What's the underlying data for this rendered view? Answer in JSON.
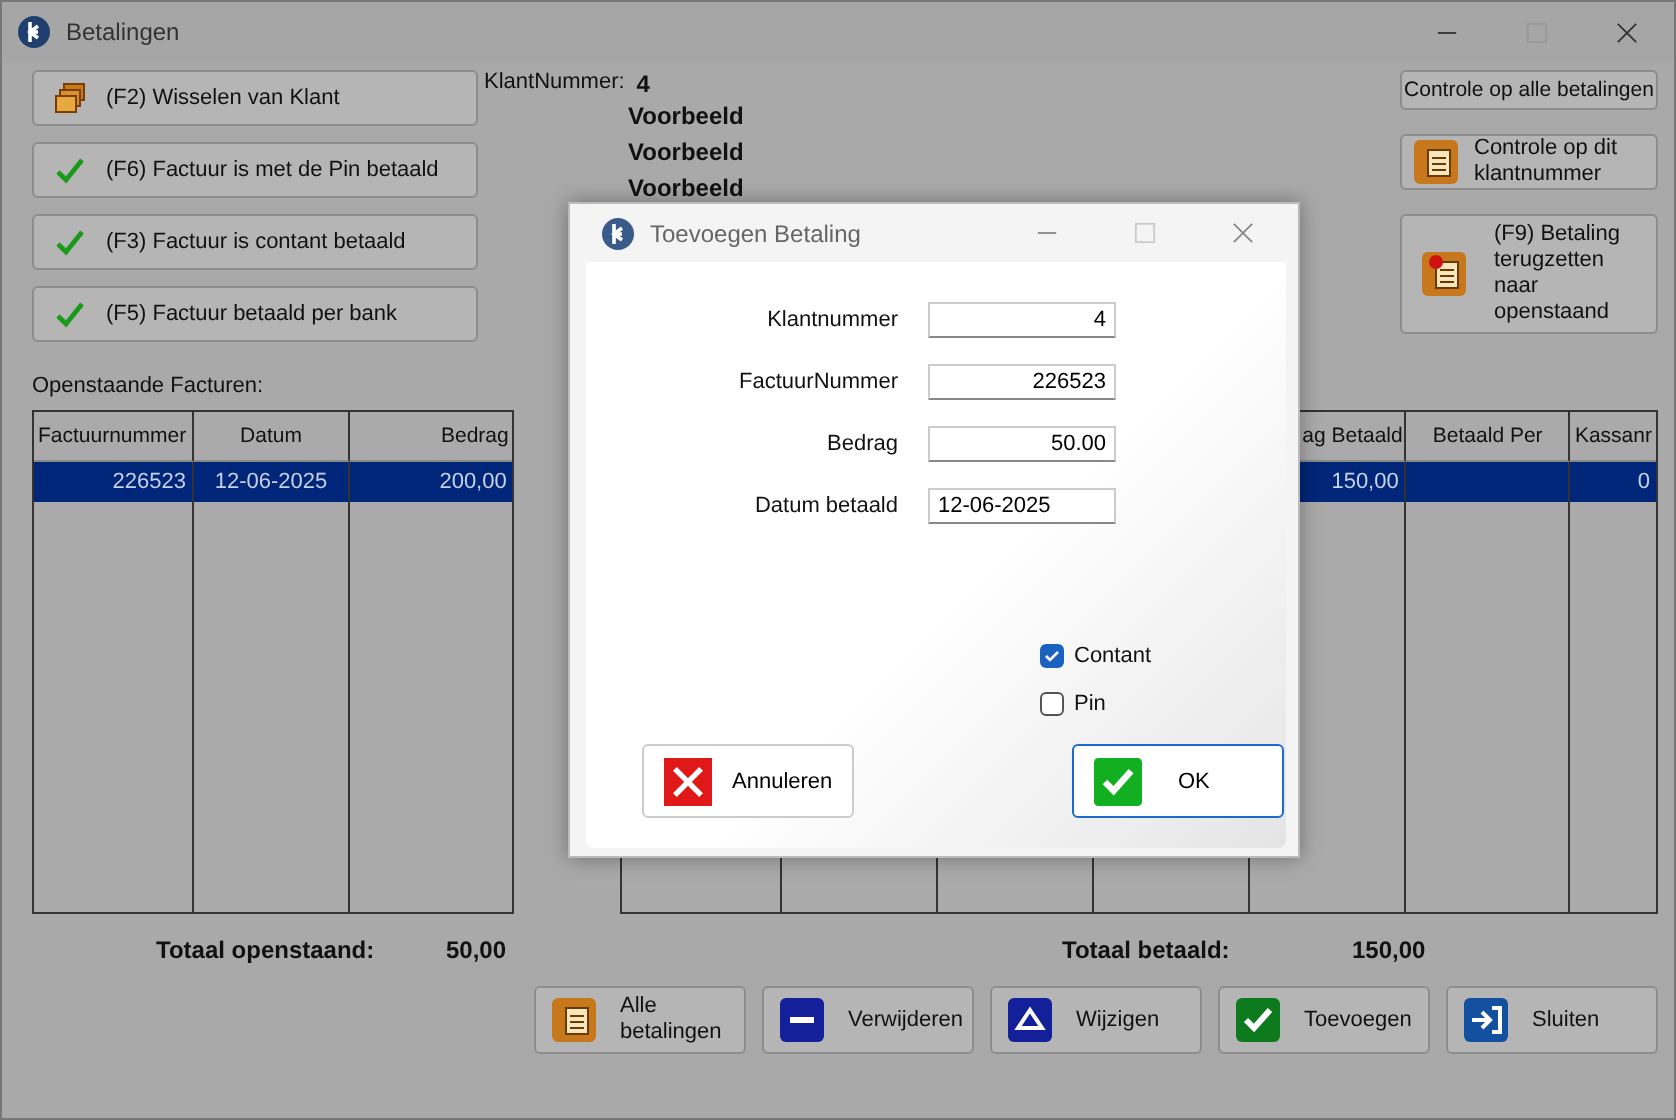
{
  "window": {
    "title": "Betalingen"
  },
  "action_buttons": [
    {
      "label": "(F2) Wisselen van Klant",
      "kind": "folder"
    },
    {
      "label": "(F6) Factuur is met de Pin betaald",
      "kind": "check"
    },
    {
      "label": "(F3) Factuur is contant betaald",
      "kind": "check"
    },
    {
      "label": "(F5) Factuur betaald per bank",
      "kind": "check"
    }
  ],
  "customer": {
    "label": "KlantNummer:",
    "number": "4",
    "lines": [
      "Voorbeeld",
      "Voorbeeld",
      "Voorbeeld"
    ]
  },
  "right_buttons": [
    {
      "label": "Controle op alle betalingen",
      "kind": "plain"
    },
    {
      "label": "Controle op dit klantnummer",
      "kind": "clipboard"
    },
    {
      "label": "(F9) Betaling terugzetten naar openstaand",
      "kind": "clipboard-red"
    }
  ],
  "open_invoices": {
    "title": "Openstaande Facturen:",
    "columns": [
      "Factuurnummer",
      "Datum",
      "Bedrag"
    ],
    "rows": [
      {
        "cells": [
          "226523",
          "12-06-2025",
          "200,00"
        ],
        "selected": true
      }
    ]
  },
  "payments": {
    "columns": [
      "ag Betaald",
      "Betaald Per",
      "Kassanr"
    ],
    "rows": [
      {
        "cells": [
          "150,00",
          "",
          "0"
        ],
        "selected": true
      }
    ]
  },
  "totals": [
    {
      "label": "Totaal openstaand:",
      "value": "50,00"
    },
    {
      "label": "Totaal betaald:",
      "value": "150,00"
    }
  ],
  "bottom_buttons": [
    {
      "label": "Alle betalingen",
      "kind": "clipboard"
    },
    {
      "label": "Verwijderen",
      "kind": "minus"
    },
    {
      "label": "Wijzigen",
      "kind": "triangle"
    },
    {
      "label": "Toevoegen",
      "kind": "check"
    },
    {
      "label": "Sluiten",
      "kind": "exit"
    }
  ],
  "dialog": {
    "title": "Toevoegen Betaling",
    "fields": [
      {
        "label": "Klantnummer",
        "value": "4",
        "kind": "number"
      },
      {
        "label": "FactuurNummer",
        "value": "226523",
        "kind": "number"
      },
      {
        "label": "Bedrag",
        "value": "50.00",
        "kind": "number"
      },
      {
        "label": "Datum betaald",
        "value": "12-06-2025",
        "kind": "date"
      }
    ],
    "checkboxes": [
      {
        "label": "Contant",
        "checked": true
      },
      {
        "label": "Pin",
        "checked": false
      }
    ],
    "cancel": "Annuleren",
    "ok": "OK"
  }
}
